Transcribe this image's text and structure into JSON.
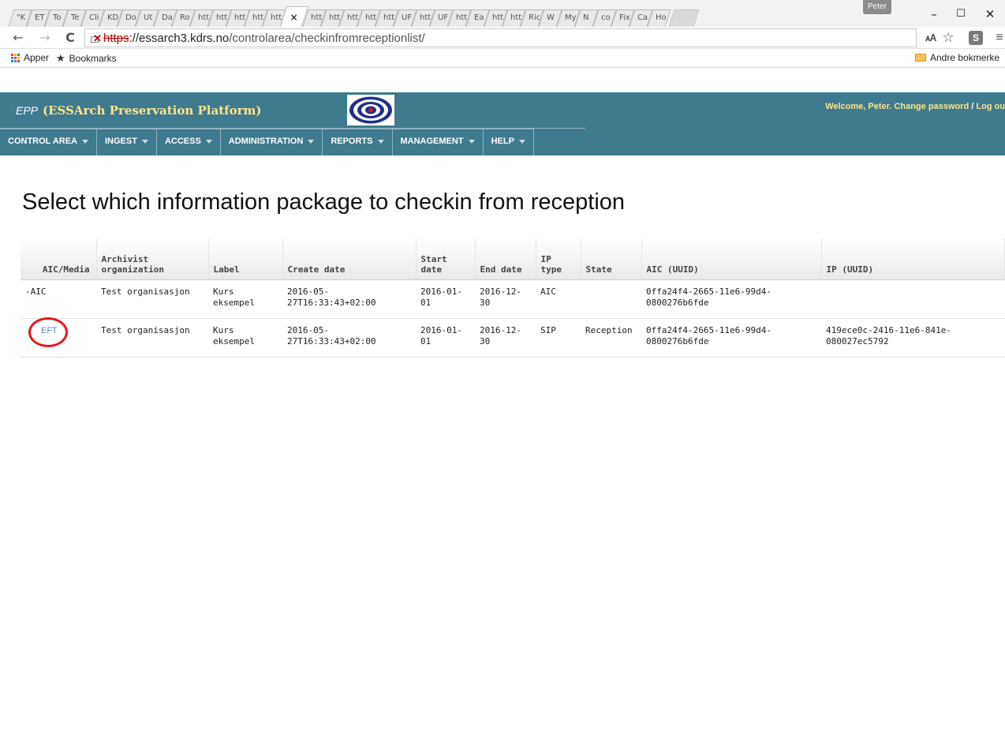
{
  "browser": {
    "profile": "Peter",
    "tabs": [
      "\"K",
      "ET",
      "To",
      "Te",
      "Cli",
      "KD",
      "Do",
      "Ut",
      "Da",
      "Ro",
      "htt",
      "htt",
      "htt",
      "htt",
      "htt",
      "×",
      "htt",
      "htt",
      "htt",
      "htt",
      "htt",
      "UF",
      "htt",
      "UF",
      "htt",
      "Ea",
      "htt",
      "htt",
      "Ric",
      "W",
      "My",
      "N",
      "co",
      "Fix",
      "Ca",
      "Ho"
    ],
    "window_controls": {
      "minimize": "–",
      "maximize": "☐",
      "close": "✕"
    },
    "url": {
      "scheme": "https",
      "host": "://essarch3.kdrs.no",
      "path": "/controlarea/checkinfromreceptionlist/"
    },
    "bookmarks_bar": {
      "apps": "Apper",
      "bookmarks": "Bookmarks",
      "other": "Andre bokmerke"
    }
  },
  "app": {
    "short_name": "EPP",
    "full_name": "(ESSArch Preservation Platform)",
    "welcome": "Welcome, Peter.",
    "change_password": "Change password",
    "separator": " / ",
    "logout": "Log ou",
    "nav": [
      {
        "label": "CONTROL AREA"
      },
      {
        "label": "INGEST"
      },
      {
        "label": "ACCESS"
      },
      {
        "label": "ADMINISTRATION"
      },
      {
        "label": "REPORTS"
      },
      {
        "label": "MANAGEMENT"
      },
      {
        "label": "HELP"
      }
    ]
  },
  "page": {
    "title": "Select which information package to checkin from reception"
  },
  "table": {
    "headers": [
      "AIC/Media",
      "Archivist organization",
      "Label",
      "Create date",
      "Start date",
      "End date",
      "IP type",
      "State",
      "AIC (UUID)",
      "IP (UUID)"
    ],
    "rows": [
      {
        "media": "-AIC",
        "org": "Test organisasjon",
        "label": "Kurs eksempel",
        "create_date": "2016-05-27T16:33:43+02:00",
        "start_date": "2016-01-01",
        "end_date": "2016-12-30",
        "ip_type": "AIC",
        "state": "",
        "aic_uuid": "0ffa24f4-2665-11e6-99d4-0800276b6fde",
        "ip_uuid": ""
      },
      {
        "media": "EFT",
        "org": "Test organisasjon",
        "label": "Kurs eksempel",
        "create_date": "2016-05-27T16:33:43+02:00",
        "start_date": "2016-01-01",
        "end_date": "2016-12-30",
        "ip_type": "SIP",
        "state": "Reception",
        "aic_uuid": "0ffa24f4-2665-11e6-99d4-0800276b6fde",
        "ip_uuid": "419ece0c-2416-11e6-841e-080027ec5792"
      }
    ]
  },
  "colors": {
    "header_bg": "#3e7b8f",
    "brand_yellow": "#ffe38a",
    "link_blue": "#5a86c8",
    "annotation_red": "#e8141c"
  }
}
